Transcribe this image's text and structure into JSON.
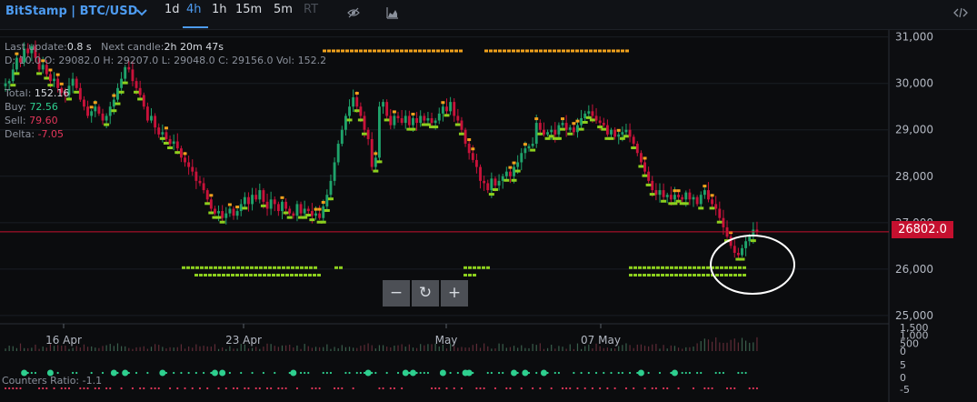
{
  "toolbar": {
    "symbol": "BitStamp | BTC/USD",
    "timeframes": [
      "1d",
      "4h",
      "1h",
      "15m",
      "5m",
      "RT"
    ],
    "active_timeframe": "4h",
    "icons": [
      "eye-off-icon",
      "area-chart-icon",
      "code-icon"
    ]
  },
  "stats": {
    "last_update_label": "Last update:",
    "last_update": "0.8 s",
    "next_candle_label": "Next candle:",
    "next_candle": "2h 20m 47s",
    "ohlc_text": "D: 10.0 O: 29082.0 H: 29207.0 L: 29048.0 C: 29156.0 Vol: 152.2",
    "total_label": "Total:",
    "total": "152.16",
    "buy_label": "Buy:",
    "buy": "72.56",
    "sell_label": "Sell:",
    "sell": "79.60",
    "delta_label": "Delta:",
    "delta": "-7.05"
  },
  "price_badge": "26802.0",
  "zoom": {
    "minus": "−",
    "reset": "↻",
    "plus": "+"
  },
  "indicator_label": "Counters Ratio: -1.1",
  "colors": {
    "background": "#0b0c0e",
    "bull": "#1fa36b",
    "bear": "#c8123a",
    "marker_green": "#8ccf1e",
    "marker_orange": "#f0a11c",
    "price_line": "#c5102f",
    "accent": "#4d9bf0"
  },
  "chart_data": {
    "type": "candlestick",
    "exchange": "BitStamp",
    "pair": "BTC/USD",
    "timeframe": "4h",
    "x_ticks": [
      "16 Apr",
      "23 Apr",
      "May",
      "07 May"
    ],
    "y_ticks": [
      "31,000",
      "30,000",
      "29,000",
      "28,000",
      "27,000",
      "26,000",
      "25,000"
    ],
    "ylim": [
      24900,
      31150
    ],
    "last_price": 26802.0,
    "close_series": [
      30000,
      30050,
      30300,
      30550,
      30450,
      30750,
      30650,
      30800,
      30550,
      30300,
      30400,
      30200,
      30050,
      30100,
      29900,
      29800,
      29750,
      29950,
      30100,
      29900,
      29650,
      29500,
      29300,
      29400,
      29500,
      29350,
      29200,
      29300,
      29500,
      29650,
      29900,
      30100,
      30350,
      30300,
      30050,
      29900,
      29750,
      29500,
      29200,
      29300,
      29050,
      28900,
      28950,
      28800,
      28700,
      28750,
      28600,
      28400,
      28300,
      28200,
      28100,
      27900,
      27850,
      27700,
      27500,
      27300,
      27200,
      27250,
      27100,
      27200,
      27300,
      27150,
      27250,
      27400,
      27550,
      27400,
      27600,
      27500,
      27700,
      27450,
      27300,
      27500,
      27400,
      27250,
      27450,
      27300,
      27200,
      27150,
      27400,
      27200,
      27300,
      27250,
      27150,
      27200,
      27100,
      27350,
      27600,
      27900,
      28300,
      28700,
      29000,
      29300,
      29500,
      29700,
      29500,
      29300,
      29000,
      28800,
      28200,
      28400,
      29500,
      29600,
      29300,
      29100,
      29300,
      29250,
      29150,
      29300,
      29100,
      29250,
      29150,
      29300,
      29200,
      29250,
      29150,
      29200,
      29350,
      29500,
      29400,
      29600,
      29300,
      29200,
      29000,
      28700,
      28500,
      28350,
      28200,
      27900,
      27850,
      27700,
      27950,
      27800,
      27900,
      28000,
      28100,
      28000,
      28200,
      28300,
      28500,
      28600,
      28650,
      28700,
      29150,
      29000,
      28900,
      28950,
      29000,
      28900,
      29100,
      29150,
      29000,
      29050,
      28950,
      29100,
      29250,
      29350,
      29400,
      29300,
      29200,
      29150,
      29100,
      28900,
      29000,
      28850,
      28900,
      28950,
      29000,
      28850,
      28700,
      28500,
      28300,
      28100,
      27900,
      27700,
      27600,
      27700,
      27550,
      27600,
      27500,
      27600,
      27550,
      27500,
      27650,
      27500,
      27550,
      27400,
      27600,
      27700,
      27500,
      27400,
      27300,
      27100,
      26900,
      26700,
      26500,
      26350,
      26300,
      26450,
      26600,
      26700,
      26850,
      26802
    ],
    "volume_ylim": [
      0,
      1500
    ],
    "volume_ticks": [
      "1,500",
      "1,000",
      "500",
      "0"
    ],
    "ratio_ticks": [
      "5",
      "0",
      "-5",
      "0",
      "-5"
    ],
    "indicator_name": "Counters Ratio",
    "indicator_value": -1.1
  }
}
